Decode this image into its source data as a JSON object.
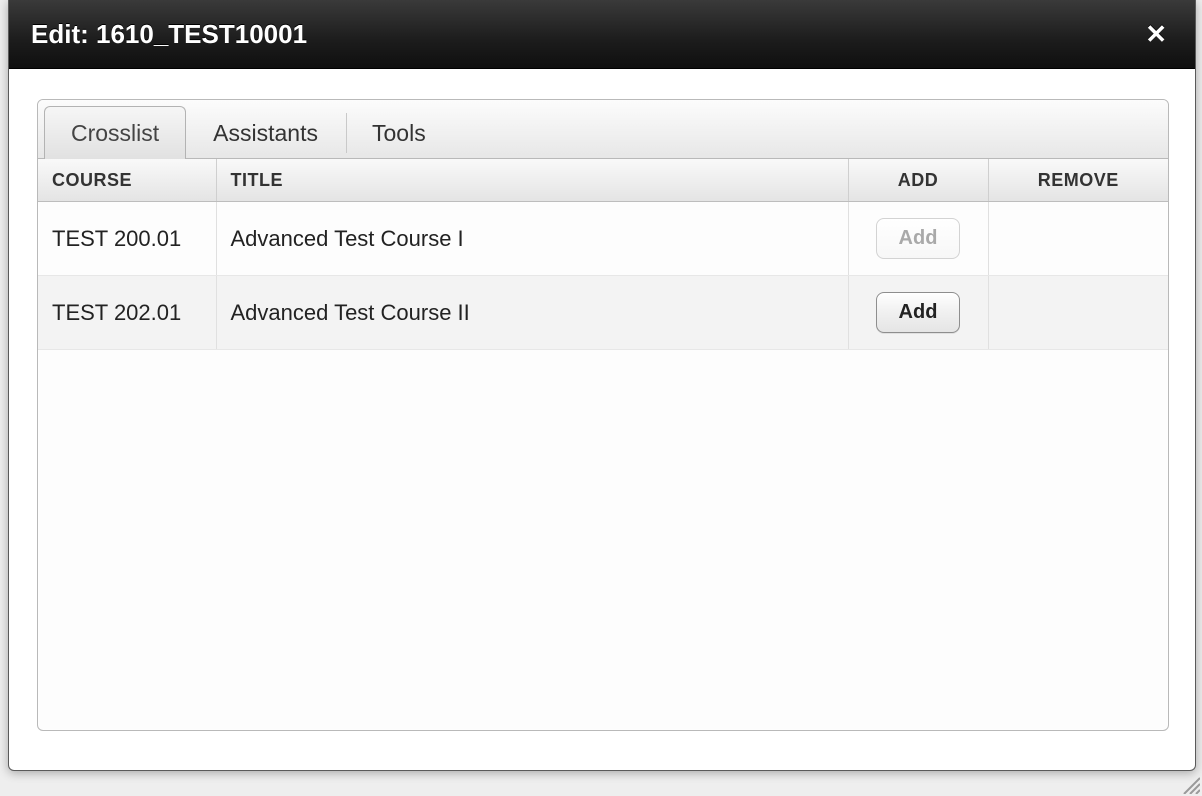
{
  "dialog": {
    "title": "Edit: 1610_TEST10001"
  },
  "tabs": [
    {
      "label": "Crosslist",
      "active": true
    },
    {
      "label": "Assistants",
      "active": false
    },
    {
      "label": "Tools",
      "active": false
    }
  ],
  "table": {
    "headers": {
      "course": "COURSE",
      "title": "TITLE",
      "add": "ADD",
      "remove": "REMOVE"
    },
    "rows": [
      {
        "course": "TEST 200.01",
        "title": "Advanced Test Course I",
        "add_label": "Add",
        "add_enabled": false
      },
      {
        "course": "TEST 202.01",
        "title": "Advanced Test Course II",
        "add_label": "Add",
        "add_enabled": true
      }
    ]
  }
}
